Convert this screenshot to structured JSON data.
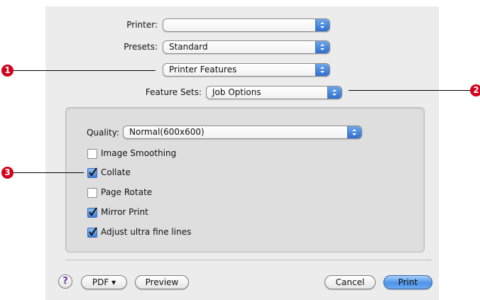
{
  "print_dialog": {
    "printer": {
      "label": "Printer:",
      "value": ""
    },
    "presets": {
      "label": "Presets:",
      "value": "Standard"
    },
    "pane": {
      "value": "Printer Features"
    },
    "feature_sets": {
      "label": "Feature Sets:",
      "value": "Job Options"
    },
    "quality": {
      "label": "Quality:",
      "value": "Normal(600x600)"
    },
    "options": [
      {
        "label": "Image Smoothing",
        "checked": false
      },
      {
        "label": "Collate",
        "checked": true
      },
      {
        "label": "Page Rotate",
        "checked": false
      },
      {
        "label": "Mirror Print",
        "checked": true
      },
      {
        "label": "Adjust ultra fine lines",
        "checked": true
      }
    ],
    "buttons": {
      "help": "?",
      "pdf": "PDF ▾",
      "preview": "Preview",
      "cancel": "Cancel",
      "print": "Print"
    }
  },
  "callouts": [
    "1",
    "2",
    "3"
  ],
  "colors": {
    "callout": "#d0021b",
    "accent": "#4f93e8",
    "dialog_bg": "#ececec"
  }
}
